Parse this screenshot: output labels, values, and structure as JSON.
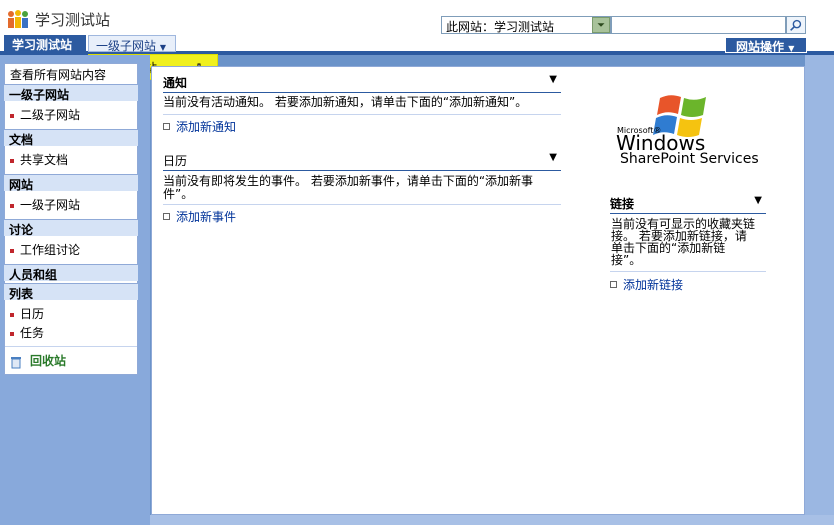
{
  "header": {
    "site_title": "学习测试站",
    "search_scope": "此网站：学习测试站",
    "search_placeholder": ""
  },
  "nav": {
    "home_tab": "学习测试站",
    "sub_tab": "一级子网站",
    "flyout_item": "二级子网站",
    "site_actions": "网站操作"
  },
  "quick_launch": {
    "view_all": "查看所有网站内容",
    "sections": [
      {
        "title": "一级子网站",
        "items": [
          "二级子网站"
        ]
      },
      {
        "title": "文档",
        "items": [
          "共享文档"
        ]
      },
      {
        "title": "网站",
        "items": [
          "一级子网站"
        ]
      },
      {
        "title": "讨论",
        "items": [
          "工作组讨论"
        ]
      },
      {
        "title": "人员和组",
        "items": []
      },
      {
        "title": "列表",
        "items": [
          "日历",
          "任务"
        ]
      }
    ],
    "recycle_bin": "回收站"
  },
  "webparts": {
    "announcements": {
      "title": "通知",
      "body": "当前没有活动通知。 若要添加新通知，请单击下面的“添加新通知”。",
      "add_link": "添加新通知"
    },
    "calendar": {
      "title": "日历",
      "body_line1": "当前没有即将发生的事件。 若要添加新事件，请单击下面的“添加新事",
      "body_line2": "件”。",
      "add_link": "添加新事件"
    },
    "links": {
      "title": "链接",
      "body_line1": "当前没有可显示的收藏夹链",
      "body_line2": "接。 若要添加新链接，请",
      "body_line3": "单击下面的“添加新链",
      "body_line4": "接”。",
      "add_link": "添加新链接"
    }
  },
  "logo": {
    "microsoft": "Microsoft®",
    "windows": "Windows",
    "product": "SharePoint Services"
  },
  "colors": {
    "nav_blue": "#2c5aa0",
    "page_bg": "#6b93c9",
    "highlight": "#f0f01e",
    "bullet_red": "#c0262c"
  }
}
